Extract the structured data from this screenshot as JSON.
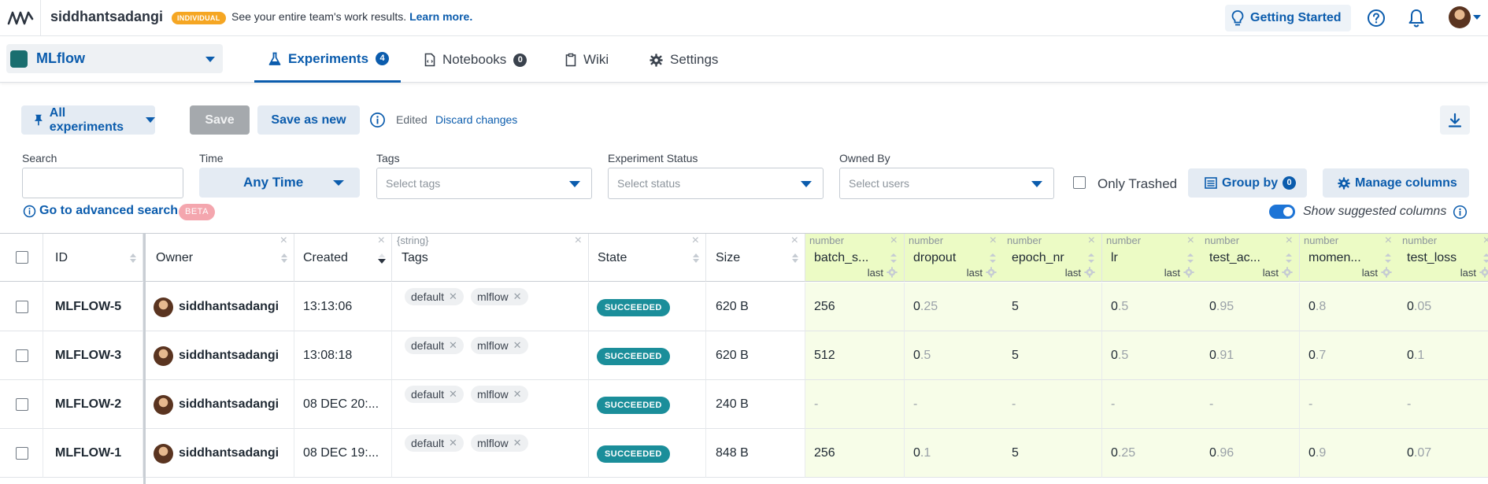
{
  "topbar": {
    "username": "siddhantsadangi",
    "plan_badge": "INDIVIDUAL",
    "promo_text": "See your entire team's work results.",
    "promo_link": "Learn more.",
    "getting_started": "Getting Started"
  },
  "projectbar": {
    "project_name": "MLflow",
    "tabs": [
      {
        "label": "Experiments",
        "count": "4"
      },
      {
        "label": "Notebooks",
        "count": "0"
      },
      {
        "label": "Wiki"
      },
      {
        "label": "Settings"
      }
    ]
  },
  "toolbar": {
    "all_experiments": "All experiments",
    "save": "Save",
    "save_as_new": "Save as new",
    "edited": "Edited",
    "discard": "Discard changes"
  },
  "filters": {
    "search_label": "Search",
    "time_label": "Time",
    "time_value": "Any Time",
    "tags_label": "Tags",
    "tags_placeholder": "Select tags",
    "status_label": "Experiment Status",
    "status_placeholder": "Select status",
    "owned_label": "Owned By",
    "owned_placeholder": "Select users",
    "only_trashed": "Only Trashed",
    "group_by": "Group by",
    "group_by_count": "0",
    "manage_columns": "Manage columns",
    "advanced_search": "Go to advanced search",
    "beta": "BETA",
    "show_suggested": "Show suggested columns"
  },
  "table": {
    "columns": {
      "id": "ID",
      "owner": "Owner",
      "created": "Created",
      "tags": "Tags",
      "tags_type": "{string}",
      "state": "State",
      "size": "Size"
    },
    "metric_columns": [
      {
        "type": "number",
        "name": "batch_s...",
        "agg": "last"
      },
      {
        "type": "number",
        "name": "dropout",
        "agg": "last"
      },
      {
        "type": "number",
        "name": "epoch_nr",
        "agg": "last"
      },
      {
        "type": "number",
        "name": "lr",
        "agg": "last"
      },
      {
        "type": "number",
        "name": "test_ac...",
        "agg": "last"
      },
      {
        "type": "number",
        "name": "momen...",
        "agg": "last"
      },
      {
        "type": "number",
        "name": "test_loss",
        "agg": "last"
      }
    ],
    "rows": [
      {
        "id": "MLFLOW-5",
        "owner": "siddhantsadangi",
        "created": "13:13:06",
        "tags": [
          "default",
          "mlflow"
        ],
        "state": "SUCCEEDED",
        "size": "620 B",
        "metrics": [
          [
            "256",
            ""
          ],
          [
            "0",
            ".25"
          ],
          [
            "5",
            ""
          ],
          [
            "0",
            ".5"
          ],
          [
            "0",
            ".95"
          ],
          [
            "0",
            ".8"
          ],
          [
            "0",
            ".05"
          ]
        ]
      },
      {
        "id": "MLFLOW-3",
        "owner": "siddhantsadangi",
        "created": "13:08:18",
        "tags": [
          "default",
          "mlflow"
        ],
        "state": "SUCCEEDED",
        "size": "620 B",
        "metrics": [
          [
            "512",
            ""
          ],
          [
            "0",
            ".5"
          ],
          [
            "5",
            ""
          ],
          [
            "0",
            ".5"
          ],
          [
            "0",
            ".91"
          ],
          [
            "0",
            ".7"
          ],
          [
            "0",
            ".1"
          ]
        ]
      },
      {
        "id": "MLFLOW-2",
        "owner": "siddhantsadangi",
        "created": "08 DEC 20:...",
        "tags": [
          "default",
          "mlflow"
        ],
        "state": "SUCCEEDED",
        "size": "240 B",
        "metrics": [
          [
            "",
            "-"
          ],
          [
            "",
            "-"
          ],
          [
            "",
            "-"
          ],
          [
            "",
            "-"
          ],
          [
            "",
            "-"
          ],
          [
            "",
            "-"
          ],
          [
            "",
            "-"
          ]
        ]
      },
      {
        "id": "MLFLOW-1",
        "owner": "siddhantsadangi",
        "created": "08 DEC 19:...",
        "tags": [
          "default",
          "mlflow"
        ],
        "state": "SUCCEEDED",
        "size": "848 B",
        "metrics": [
          [
            "256",
            ""
          ],
          [
            "0",
            ".1"
          ],
          [
            "5",
            ""
          ],
          [
            "0",
            ".25"
          ],
          [
            "0",
            ".96"
          ],
          [
            "0",
            ".9"
          ],
          [
            "0",
            ".07"
          ]
        ]
      }
    ]
  }
}
